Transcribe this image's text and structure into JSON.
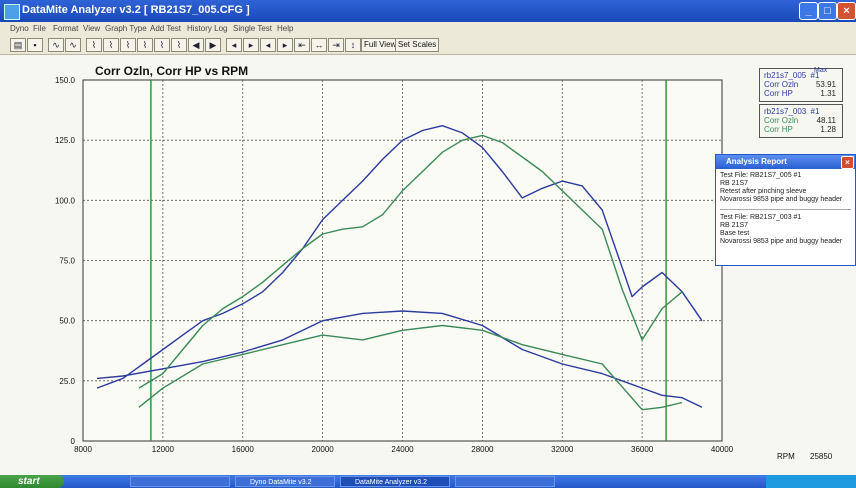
{
  "window": {
    "title": "DataMite Analyzer v3.2 [ RB21S7_005.CFG ]"
  },
  "menu": [
    "Dyno",
    "File",
    "Format",
    "View",
    "Graph Type",
    "Add Test",
    "History Log",
    "Single Test",
    "Help"
  ],
  "toolbar": {
    "full_view_label": "Full View",
    "set_scales_label": "Set Scales"
  },
  "chart_data": {
    "type": "line",
    "title": "Corr Ozln, Corr HP vs RPM",
    "xlabel": "RPM",
    "x_readout": "25850",
    "xlim": [
      8000,
      40000
    ],
    "ylim": [
      0,
      150
    ],
    "xticks": [
      "8000",
      "12000",
      "16000",
      "20000",
      "24000",
      "28000",
      "32000",
      "36000",
      "40000"
    ],
    "yticks": [
      "0",
      "25.0",
      "50.0",
      "75.0",
      "100.0",
      "125.0",
      "150.0"
    ],
    "grid": true,
    "series": [
      {
        "name": "rb21s7_005 Corr Ozln",
        "color": "#2b3a9e",
        "x": [
          8700,
          10000,
          11000,
          12000,
          13000,
          14000,
          15000,
          16000,
          17000,
          18000,
          19000,
          20000,
          21000,
          22000,
          23000,
          24000,
          25000,
          26000,
          27000,
          28000,
          29000,
          30000,
          31000,
          32000,
          33000,
          34000,
          35000,
          35500,
          36000,
          37000,
          38000,
          39000
        ],
        "y": [
          22,
          26,
          32,
          38,
          44,
          50,
          53,
          57,
          62,
          70,
          80,
          92,
          100,
          108,
          117,
          125,
          129,
          131,
          128,
          122,
          112,
          101,
          105,
          108,
          106,
          96,
          72,
          60,
          64,
          70,
          62,
          50
        ]
      },
      {
        "name": "rb21s7_005 Corr HP",
        "color": "#2b3a9e",
        "x": [
          8700,
          10000,
          12000,
          14000,
          16000,
          18000,
          20000,
          22000,
          24000,
          26000,
          28000,
          30000,
          32000,
          34000,
          36000,
          37000,
          38000,
          39000
        ],
        "y": [
          26,
          27,
          30,
          33,
          37,
          42,
          50,
          53,
          54,
          53,
          48,
          38,
          32,
          28,
          22,
          19,
          18,
          14
        ]
      },
      {
        "name": "rb21s7_003 Corr Ozln",
        "color": "#3a8a58",
        "x": [
          10800,
          12000,
          13000,
          14000,
          15000,
          16000,
          17000,
          18000,
          19000,
          20000,
          21000,
          22000,
          23000,
          24000,
          25000,
          26000,
          27000,
          28000,
          29000,
          30000,
          31000,
          32000,
          33000,
          34000,
          35000,
          36000,
          37000,
          38000
        ],
        "y": [
          22,
          28,
          38,
          48,
          55,
          60,
          66,
          73,
          80,
          86,
          88,
          89,
          94,
          104,
          112,
          120,
          125,
          127,
          124,
          118,
          112,
          104,
          96,
          88,
          63,
          42,
          55,
          62
        ]
      },
      {
        "name": "rb21s7_003 Corr HP",
        "color": "#3a8a58",
        "x": [
          10800,
          12000,
          14000,
          16000,
          18000,
          20000,
          22000,
          24000,
          26000,
          28000,
          30000,
          32000,
          34000,
          36000,
          37000,
          38000
        ],
        "y": [
          14,
          22,
          32,
          36,
          40,
          44,
          42,
          46,
          48,
          46,
          40,
          36,
          32,
          13,
          14,
          16
        ]
      }
    ]
  },
  "legend1": {
    "title": "rb21s7_005",
    "num": "#1",
    "rows": [
      {
        "label": "Corr Ozln",
        "value": "53.91"
      },
      {
        "label": "Corr HP",
        "value": "1.31"
      }
    ],
    "max_label": "Max"
  },
  "legend2": {
    "title": "rb21s7_003",
    "num": "#1",
    "rows": [
      {
        "label": "Corr Ozln",
        "value": "48.11"
      },
      {
        "label": "Corr HP",
        "value": "1.28"
      }
    ]
  },
  "analysis": {
    "title": "Analysis Report",
    "test1": [
      "Test File:  RB21S7_005   #1",
      "RB 21S7",
      "Retest after pinching sleeve",
      "Novarossi 9853 pipe and buggy header"
    ],
    "test2": [
      "Test File:  RB21S7_003   #1",
      "RB 21S7",
      "Base test",
      "Novarossi 9853 pipe and buggy header"
    ]
  },
  "taskbar": {
    "start": "start",
    "tasks": [
      "",
      "Dyno DataMite v3.2",
      "DataMite Analyzer v3.2",
      ""
    ]
  },
  "colors": {
    "series_005": "#2b3a9e",
    "series_003": "#3a8a58",
    "marker": "#2f9a3a"
  }
}
